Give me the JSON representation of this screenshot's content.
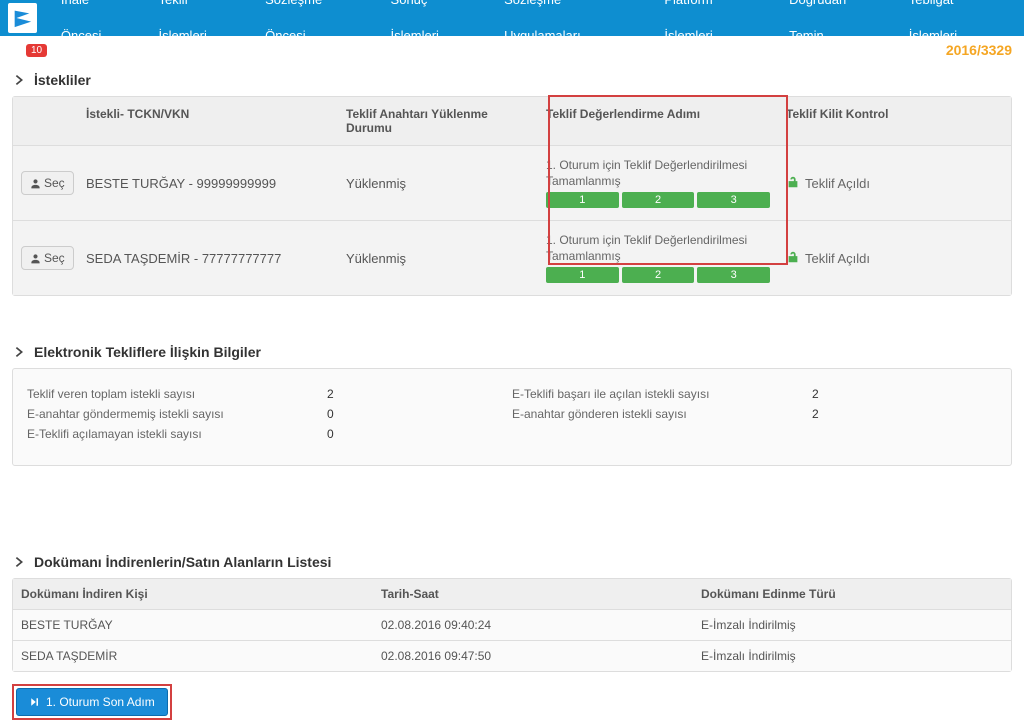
{
  "menu": {
    "items": [
      "İhale Öncesi",
      "Teklif İşlemleri",
      "Sözleşme Öncesi",
      "Sonuç İşlemleri",
      "Sözleşme Uygulamaları",
      "Platform İşlemleri",
      "Doğrudan Temin",
      "Tebligat İşlemleri"
    ]
  },
  "badge": "10",
  "ref": "2016/3329",
  "istekliler": {
    "title": "İstekliler",
    "headers": {
      "name": "İstekli- TCKN/VKN",
      "load": "Teklif Anahtarı Yüklenme Durumu",
      "step": "Teklif Değerlendirme Adımı",
      "lock": "Teklif Kilit Kontrol"
    },
    "select_label": "Seç",
    "step_text": "1. Oturum için Teklif Değerlendirilmesi Tamamlanmış",
    "steps": [
      "1",
      "2",
      "3"
    ],
    "lock_text": "Teklif Açıldı",
    "rows": [
      {
        "name": "BESTE TURĞAY - 99999999999",
        "load": "Yüklenmiş"
      },
      {
        "name": "SEDA TAŞDEMİR - 77777777777",
        "load": "Yüklenmiş"
      }
    ]
  },
  "einfo": {
    "title": "Elektronik Tekliflere İlişkin Bilgiler",
    "rows": [
      {
        "l1": "Teklif veren toplam istekli sayısı",
        "v1": "2",
        "l2": "E-Teklifi başarı ile açılan istekli sayısı",
        "v2": "2"
      },
      {
        "l1": "E-anahtar göndermemiş istekli sayısı",
        "v1": "0",
        "l2": "E-anahtar gönderen istekli sayısı",
        "v2": "2"
      },
      {
        "l1": "E-Teklifi açılamayan istekli sayısı",
        "v1": "0",
        "l2": "",
        "v2": ""
      }
    ]
  },
  "docs": {
    "title": "Dokümanı İndirenlerin/Satın Alanların Listesi",
    "headers": {
      "who": "Dokümanı İndiren Kişi",
      "when": "Tarih-Saat",
      "how": "Dokümanı Edinme Türü"
    },
    "rows": [
      {
        "who": "BESTE TURĞAY",
        "when": "02.08.2016 09:40:24",
        "how": "E-İmzalı İndirilmiş"
      },
      {
        "who": "SEDA TAŞDEMİR",
        "when": "02.08.2016 09:47:50",
        "how": "E-İmzalı İndirilmiş"
      }
    ]
  },
  "final_btn": "1. Oturum Son Adım"
}
